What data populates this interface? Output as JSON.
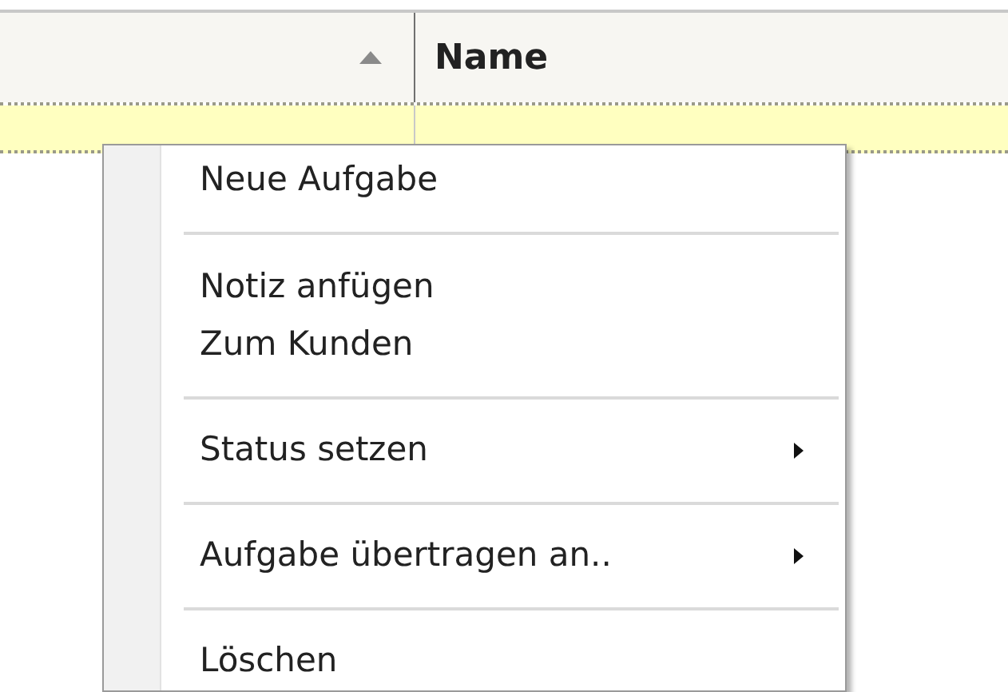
{
  "table": {
    "columns": [
      {
        "sorted": true
      },
      {
        "label": "Name",
        "sorted": false
      }
    ],
    "rows": [
      {
        "selected": true
      }
    ]
  },
  "context_menu": {
    "items": [
      {
        "kind": "item",
        "label": "Neue Aufgabe",
        "submenu": false
      },
      {
        "kind": "separator"
      },
      {
        "kind": "item",
        "label": "Notiz anfügen",
        "submenu": false
      },
      {
        "kind": "item",
        "label": "Zum Kunden",
        "submenu": false
      },
      {
        "kind": "separator"
      },
      {
        "kind": "item",
        "label": "Status setzen",
        "submenu": true
      },
      {
        "kind": "separator"
      },
      {
        "kind": "item",
        "label": "Aufgabe übertragen an..",
        "submenu": true
      },
      {
        "kind": "separator"
      },
      {
        "kind": "item",
        "label": "Löschen",
        "submenu": false
      }
    ]
  }
}
